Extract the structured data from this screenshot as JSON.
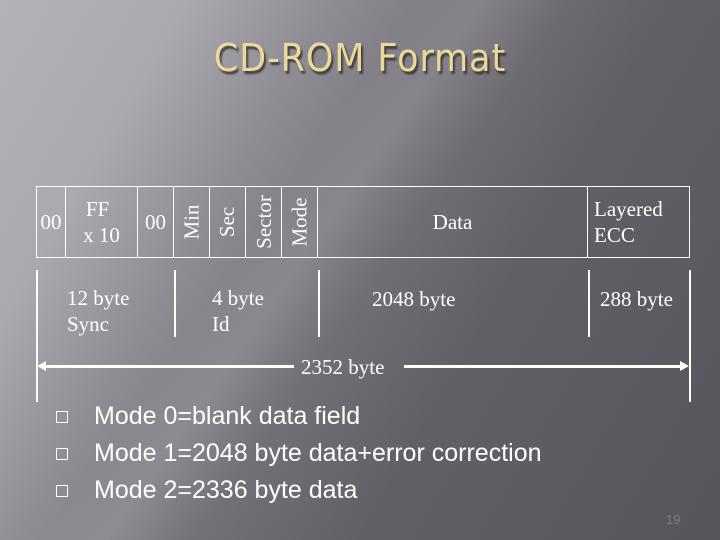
{
  "slide": {
    "title": "CD-ROM Format",
    "page_number": "19"
  },
  "sector_table": {
    "cells": [
      {
        "label": "00"
      },
      {
        "label_line1": "FF",
        "label_line2": "x 10"
      },
      {
        "label": "00"
      },
      {
        "label": "Min"
      },
      {
        "label": "Sec"
      },
      {
        "label": "Sector"
      },
      {
        "label": "Mode"
      },
      {
        "label": "Data"
      },
      {
        "label_line1": "Layered",
        "label_line2": "ECC"
      }
    ]
  },
  "field_sizes": {
    "sync": {
      "line1": "12 byte",
      "line2": "Sync"
    },
    "id": {
      "line1": "4 byte",
      "line2": "Id"
    },
    "data": {
      "label": "2048 byte"
    },
    "ecc": {
      "label": "288 byte"
    }
  },
  "total": {
    "label": "2352 byte"
  },
  "bullets": [
    {
      "text": "Mode 0=blank data field"
    },
    {
      "text": "Mode 1=2048 byte data+error correction"
    },
    {
      "text": "Mode 2=2336 byte data"
    }
  ],
  "colors": {
    "title": "#ecd99a",
    "text": "#ffffff",
    "background_light": "#b4b2b8",
    "background_dark": "#57555c"
  }
}
